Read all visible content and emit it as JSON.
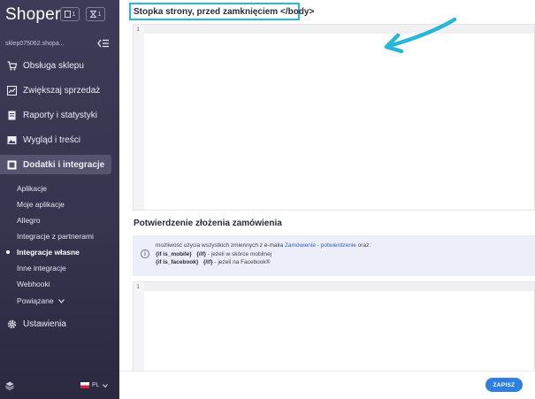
{
  "sidebar": {
    "logo": "Shoper",
    "badge1_count": "1",
    "badge2_count": "1",
    "shop_name": "sklep075062.shopa...",
    "menu": [
      {
        "label": "Obsługa sklepu",
        "icon": "cart-icon"
      },
      {
        "label": "Zwiększaj sprzedaż",
        "icon": "chart-icon"
      },
      {
        "label": "Raporty i statystyki",
        "icon": "report-icon"
      },
      {
        "label": "Wygląd i treści",
        "icon": "image-icon"
      },
      {
        "label": "Dodatki i integracje",
        "icon": "addons-icon"
      }
    ],
    "submenu": [
      {
        "label": "Aplikacje"
      },
      {
        "label": "Moje aplikacje"
      },
      {
        "label": "Allegro"
      },
      {
        "label": "Integracje z partnerami"
      },
      {
        "label": "Integracje własne"
      },
      {
        "label": "Inne integracje"
      },
      {
        "label": "Webhooki"
      },
      {
        "label": "Powiązane"
      }
    ],
    "settings_label": "Ustawienia",
    "language": "PL"
  },
  "main": {
    "section1_title": "Stopka strony, przed zamknięciem </body>",
    "editor1_line": "1",
    "section2_title": "Potwierdzenie złożenia zamówienia",
    "info": {
      "text_before": "możliwość użycia wszystkich zmiennych z e-maila ",
      "link": "Zamówienie - potwierdzenie",
      "text_after": " oraz:",
      "mobile_tag": "{if is_mobile}",
      "mobile_end": "{/if}",
      "mobile_desc": " - jeżeli w skórce mobilnej",
      "facebook_tag": "{if is_facebook}",
      "facebook_end": "{/if}",
      "facebook_desc": " - jeżeli na Facebook®"
    },
    "editor2_line": "1",
    "save_label": "ZAPISZ"
  },
  "colors": {
    "sidebar_bg": "#3d3b57",
    "highlight_border": "#27b8d8",
    "arrow": "#27b8d8",
    "save_button": "#2f7fe0",
    "link": "#3a57c9"
  }
}
